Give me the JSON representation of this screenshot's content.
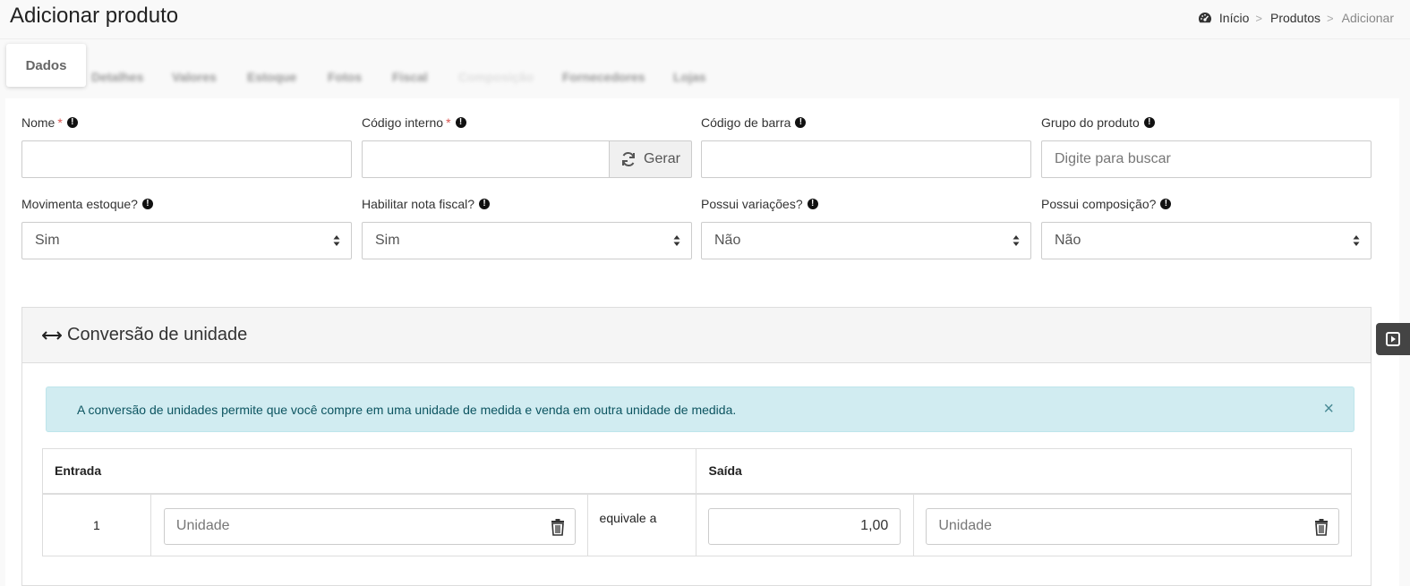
{
  "page": {
    "title": "Adicionar produto"
  },
  "breadcrumb": {
    "home": "Início",
    "products": "Produtos",
    "current": "Adicionar",
    "separator": ">"
  },
  "tabs": {
    "active": "Dados",
    "others": [
      "Detalhes",
      "Valores",
      "Estoque",
      "Fotos",
      "Fiscal",
      "Composição",
      "Fornecedores",
      "Lojas"
    ]
  },
  "fields": {
    "nome": {
      "label": "Nome",
      "value": ""
    },
    "codigo_interno": {
      "label": "Código interno",
      "value": "",
      "button": "Gerar"
    },
    "codigo_barra": {
      "label": "Código de barra",
      "value": ""
    },
    "grupo": {
      "label": "Grupo do produto",
      "placeholder": "Digite para buscar"
    },
    "movimenta_estoque": {
      "label": "Movimenta estoque?",
      "value": "Sim"
    },
    "nota_fiscal": {
      "label": "Habilitar nota fiscal?",
      "value": "Sim"
    },
    "variacoes": {
      "label": "Possui variações?",
      "value": "Não"
    },
    "composicao": {
      "label": "Possui composição?",
      "value": "Não"
    }
  },
  "required_mark": "*",
  "info_mark": "!",
  "conversion": {
    "title": "Conversão de unidade",
    "alert": "A conversão de unidades permite que você compre em uma unidade de medida e venda em outra unidade de medida.",
    "close": "×",
    "headers": {
      "entrada": "Entrada",
      "saida": "Saída"
    },
    "row": {
      "qty_in": "1",
      "unit_in_placeholder": "Unidade",
      "equivale": "equivale a",
      "qty_out": "1,00",
      "unit_out_placeholder": "Unidade"
    }
  },
  "colors": {
    "required": "#d9534f",
    "alert_bg": "#d1ecf1",
    "alert_text": "#0c5460"
  }
}
